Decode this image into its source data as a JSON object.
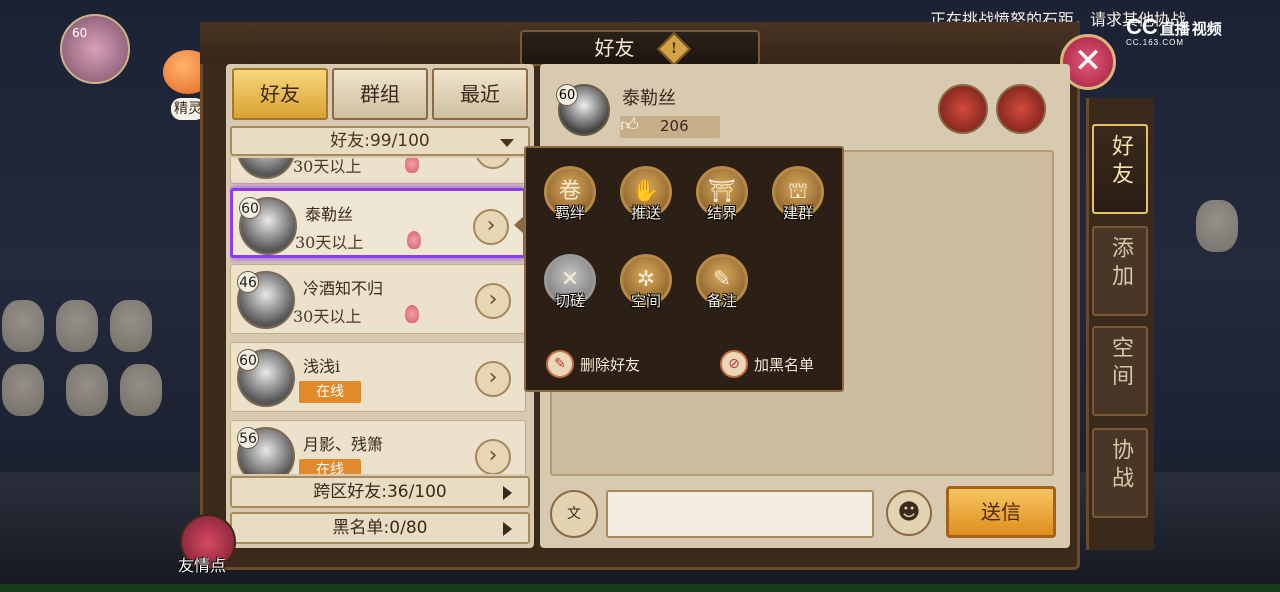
{
  "marquee_text": "正在挑战愤怒的石距，请求其他协战",
  "watermark": {
    "brand": "CC",
    "badge": "直播",
    "extra": "视频",
    "domain": "CC.163.COM"
  },
  "hud": {
    "avatar_level": "60",
    "spirit_label": "精灵"
  },
  "panel": {
    "title": "好友",
    "warning_icon": "!"
  },
  "tabs": [
    {
      "label": "好友",
      "active": true
    },
    {
      "label": "群组",
      "active": false
    },
    {
      "label": "最近",
      "active": false
    }
  ],
  "group_dropdown": "好友:99/100",
  "friends": [
    {
      "level": "",
      "name": "",
      "status": "30天以上",
      "online": false
    },
    {
      "level": "60",
      "name": "泰勒丝",
      "status": "30天以上",
      "online": false,
      "selected": true
    },
    {
      "level": "46",
      "name": "冷酒知不归",
      "status": "30天以上",
      "online": false
    },
    {
      "level": "60",
      "name": "浅浅i",
      "status": "在线",
      "online": true
    },
    {
      "level": "56",
      "name": "月影、残箫",
      "status": "在线",
      "online": true
    }
  ],
  "cross_server": "跨区好友:36/100",
  "blacklist": "黑名单:0/80",
  "chat": {
    "level": "60",
    "name": "泰勒丝",
    "likes": "206",
    "send_label": "送信",
    "voice_label": "文",
    "emoji": "☻"
  },
  "popup": {
    "items": [
      {
        "label": "羁绊",
        "icon": "bond-icon",
        "glyph": "卷",
        "disabled": false
      },
      {
        "label": "推送",
        "icon": "push-icon",
        "glyph": "✋",
        "disabled": false
      },
      {
        "label": "结界",
        "icon": "barrier-icon",
        "glyph": "⛩",
        "disabled": false
      },
      {
        "label": "建群",
        "icon": "create-group-icon",
        "glyph": "⛫",
        "disabled": false
      },
      {
        "label": "切磋",
        "icon": "duel-icon",
        "glyph": "✕",
        "disabled": true
      },
      {
        "label": "空间",
        "icon": "space-icon",
        "glyph": "✲",
        "disabled": false
      },
      {
        "label": "备注",
        "icon": "note-icon",
        "glyph": "✎",
        "disabled": false
      }
    ],
    "delete_friend": "删除好友",
    "add_blacklist": "加黑名单"
  },
  "side_tabs": [
    {
      "label": "好友",
      "active": true
    },
    {
      "label": "添加",
      "active": false
    },
    {
      "label": "空间",
      "active": false
    },
    {
      "label": "协战",
      "active": false
    }
  ],
  "friend_point_label": "友情点",
  "colors": {
    "accent": "#e2892c",
    "selected_border": "#8b3cf0",
    "panel": "#3b2a1c"
  }
}
